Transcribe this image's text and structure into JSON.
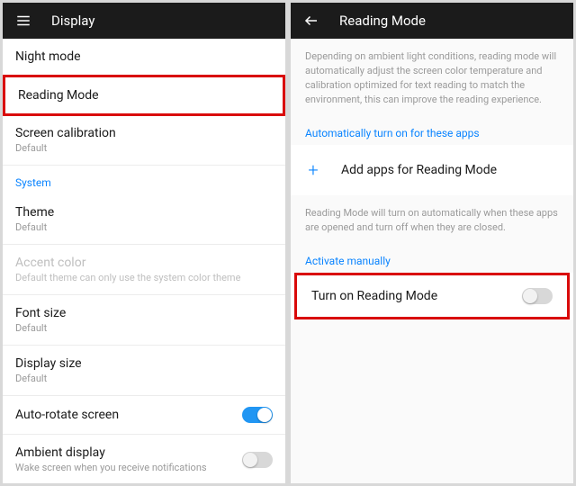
{
  "left": {
    "header": {
      "title": "Display"
    },
    "items": [
      {
        "title": "Night mode"
      },
      {
        "title": "Reading Mode",
        "highlight": true
      },
      {
        "title": "Screen calibration",
        "sub": "Default"
      }
    ],
    "section_header": "System",
    "system_items": [
      {
        "title": "Theme",
        "sub": "Default"
      },
      {
        "title": "Accent color",
        "sub": "Default theme can only use the system color theme",
        "disabled": true
      },
      {
        "title": "Font size",
        "sub": "Default"
      },
      {
        "title": "Display size",
        "sub": "Default"
      },
      {
        "title": "Auto-rotate screen",
        "toggle": "on"
      },
      {
        "title": "Ambient display",
        "sub": "Wake screen when you receive notifications",
        "toggle": "off"
      }
    ]
  },
  "right": {
    "header": {
      "title": "Reading Mode"
    },
    "desc1": "Depending on ambient light conditions, reading mode will automatically adjust the screen color temperature and calibration optimized for text reading to match the environment, this can improve the reading experience.",
    "auto_header": "Automatically turn on for these apps",
    "add_label": "Add apps for Reading Mode",
    "desc2": "Reading Mode will turn on automatically when these apps are opened and turn off when they are closed.",
    "activate_header": "Activate manually",
    "toggle_label": "Turn on Reading Mode"
  }
}
